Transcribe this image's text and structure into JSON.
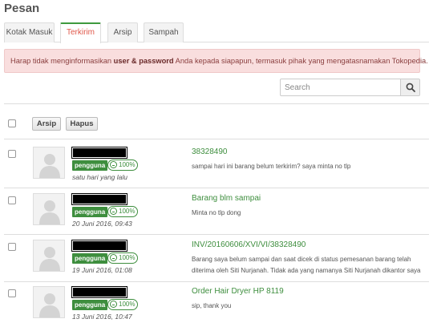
{
  "page": {
    "title": "Pesan"
  },
  "tabs": [
    {
      "label": "Kotak Masuk",
      "active": false
    },
    {
      "label": "Terkirim",
      "active": true
    },
    {
      "label": "Arsip",
      "active": false
    },
    {
      "label": "Sampah",
      "active": false
    }
  ],
  "alert": {
    "prefix": "Harap tidak menginformasikan ",
    "bold": "user & password",
    "suffix": " Anda kepada siapapun, termasuk pihak yang mengatasnamakan Tokopedia."
  },
  "search": {
    "placeholder": "Search",
    "value": ""
  },
  "toolbar": {
    "archive_label": "Arsip",
    "delete_label": "Hapus"
  },
  "messages": [
    {
      "badge": "pengguna",
      "rating": "100%",
      "time": "satu hari yang lalu",
      "subject": "38328490",
      "snippet": "sampai hari ini barang belum terkirim? saya minta no tlp"
    },
    {
      "badge": "pengguna",
      "rating": "100%",
      "time": "20 Juni 2016, 09:43",
      "subject": "Barang blm sampai",
      "snippet": "Minta no tlp dong"
    },
    {
      "badge": "pengguna",
      "rating": "100%",
      "time": "19 Juni 2016, 01:08",
      "subject": "INV/20160606/XVI/VI/38328490",
      "snippet": "Barang saya belum sampai dan saat dicek di status pemesanan barang telah diterima oleh Siti Nurjanah. Tidak ada yang namanya Siti Nurjanah dikantor saya"
    },
    {
      "badge": "pengguna",
      "rating": "100%",
      "time": "13 Juni 2016, 10:47",
      "subject": "Order Hair Dryer HP 8119",
      "snippet": "sip, thank you"
    }
  ],
  "colors": {
    "accent_green": "#3e8e3e",
    "alert_bg": "#f9dede",
    "active_tab_text": "#e0584a"
  }
}
